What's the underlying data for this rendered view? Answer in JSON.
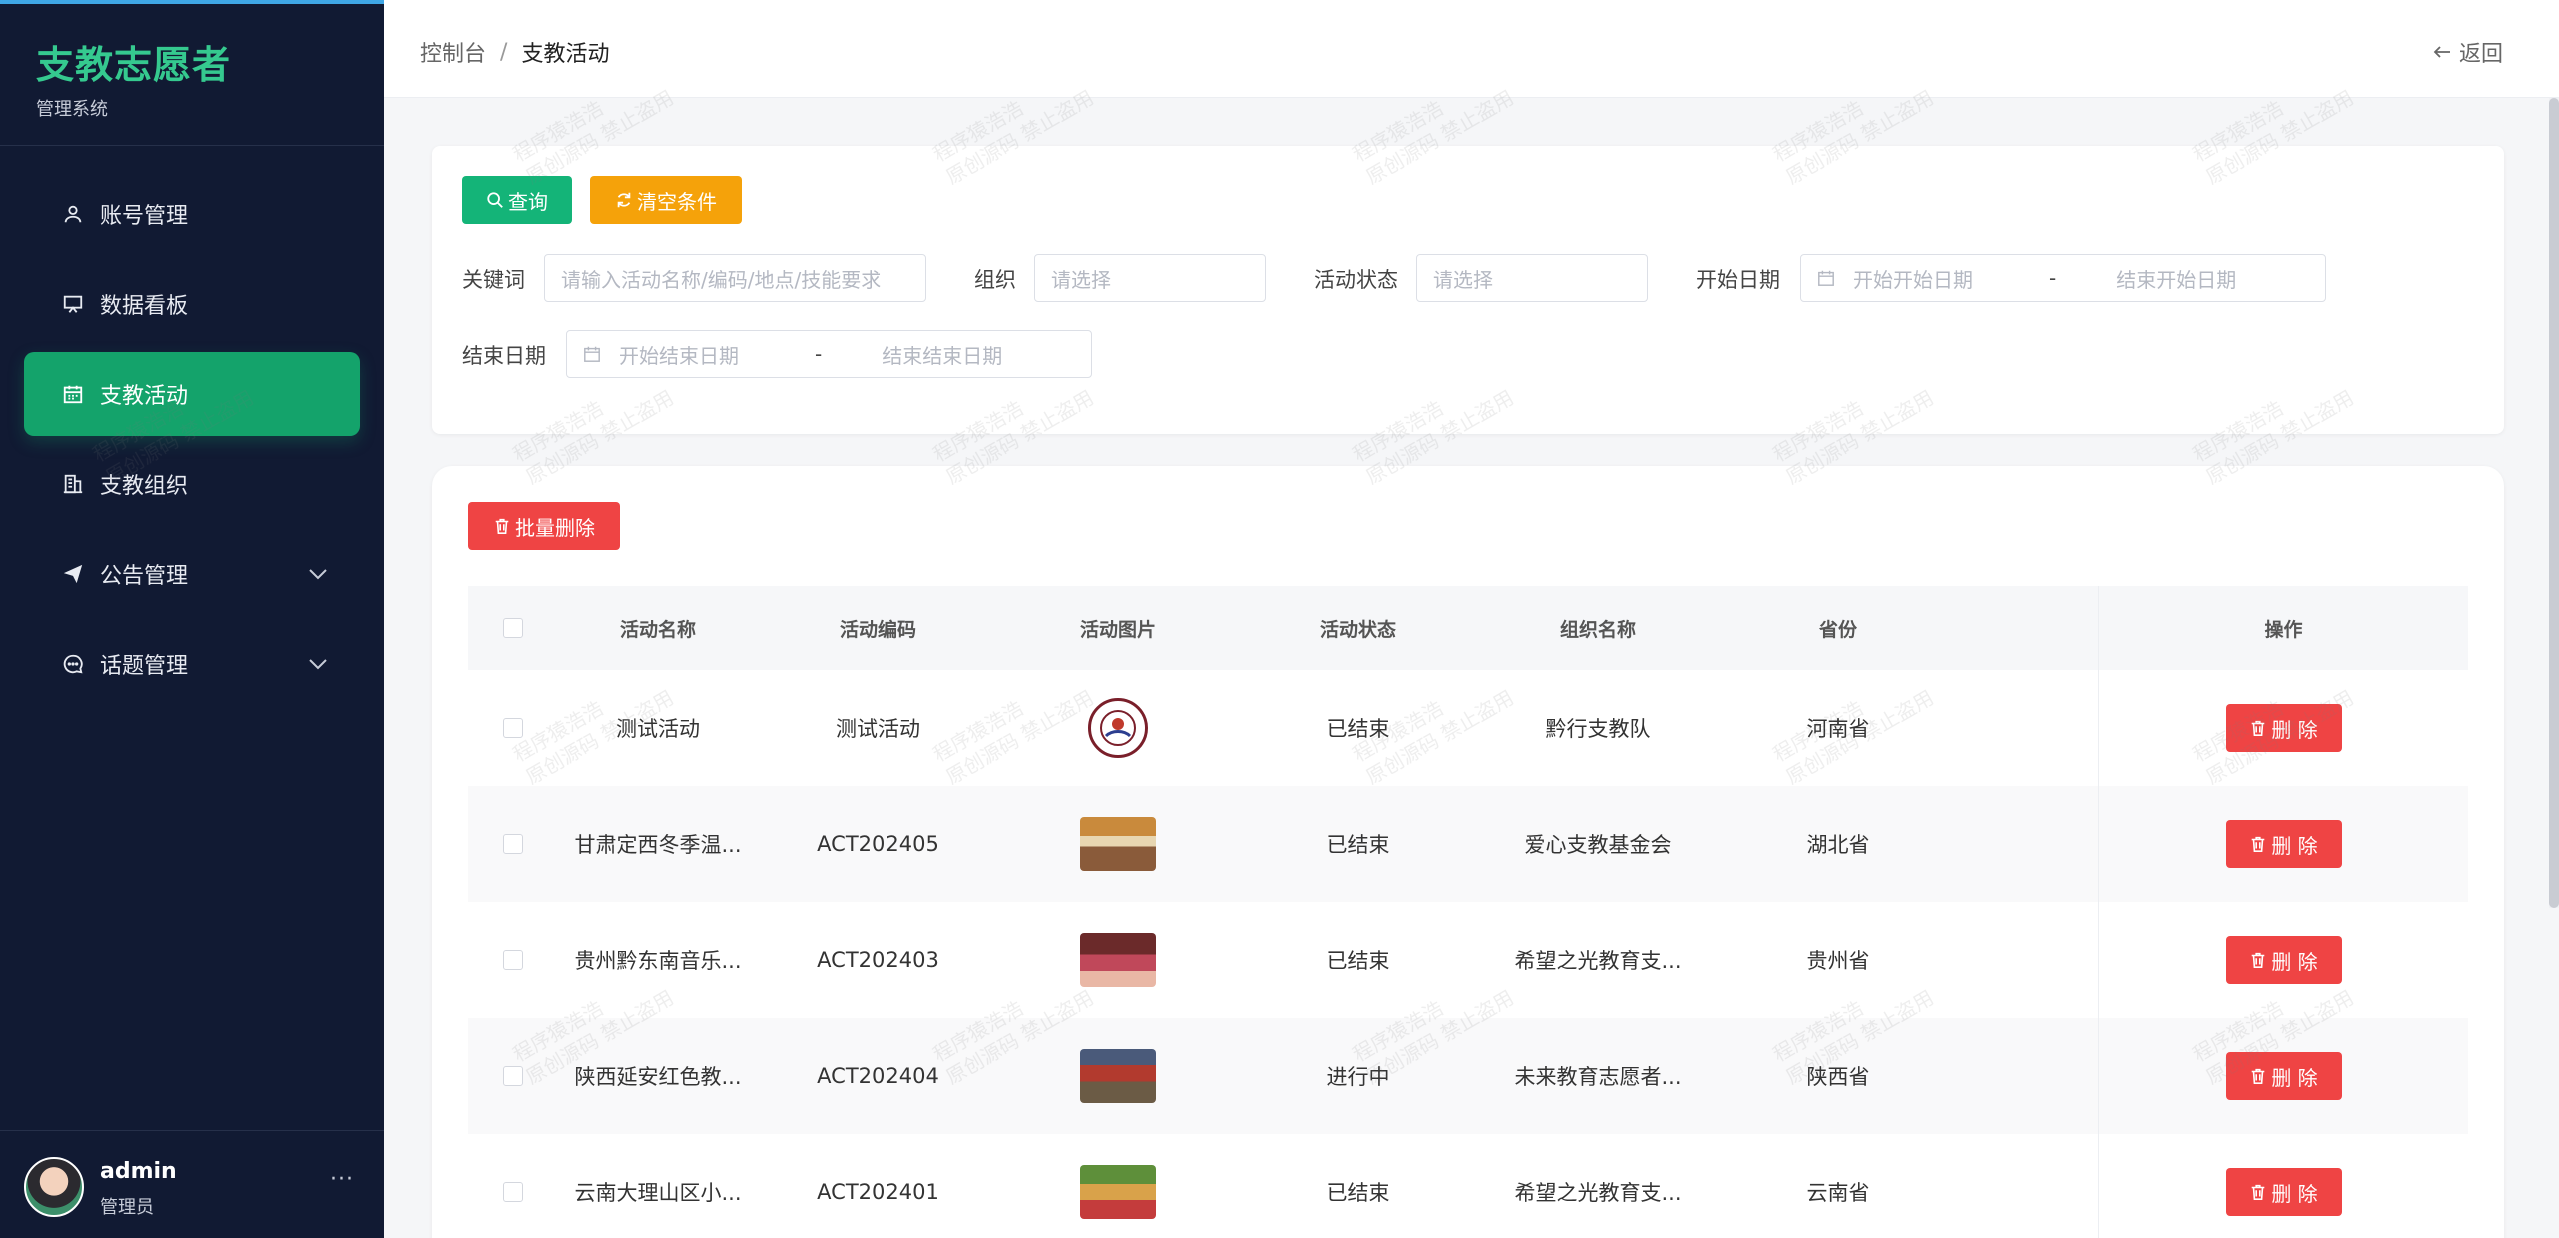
{
  "sidebar": {
    "brand_title": "支教志愿者",
    "brand_sub": "管理系统",
    "items": [
      {
        "label": "账号管理",
        "icon": "user-icon"
      },
      {
        "label": "数据看板",
        "icon": "board-icon"
      },
      {
        "label": "支教活动",
        "icon": "calendar-icon",
        "active": true
      },
      {
        "label": "支教组织",
        "icon": "building-icon"
      },
      {
        "label": "公告管理",
        "icon": "send-icon",
        "expandable": true
      },
      {
        "label": "话题管理",
        "icon": "chat-icon",
        "expandable": true
      }
    ],
    "user": {
      "name": "admin",
      "role": "管理员",
      "more": "···"
    }
  },
  "header": {
    "breadcrumb": [
      "控制台",
      "支教活动"
    ],
    "breadcrumb_sep": "/",
    "back_label": "返回"
  },
  "filter": {
    "query_label": "查询",
    "clear_label": "清空条件",
    "keyword_label": "关键词",
    "keyword_placeholder": "请输入活动名称/编码/地点/技能要求",
    "org_label": "组织",
    "org_placeholder": "请选择",
    "status_label": "活动状态",
    "status_placeholder": "请选择",
    "start_label": "开始日期",
    "start_from_placeholder": "开始开始日期",
    "start_to_placeholder": "结束开始日期",
    "end_label": "结束日期",
    "end_from_placeholder": "开始结束日期",
    "end_to_placeholder": "结束结束日期",
    "range_sep": "-"
  },
  "table": {
    "batch_delete_label": "批量删除",
    "columns": [
      "活动名称",
      "活动编码",
      "活动图片",
      "活动状态",
      "组织名称",
      "省份",
      "操作"
    ],
    "delete_label": "删 除",
    "rows": [
      {
        "name": "测试活动",
        "code": "测试活动",
        "image": "logo",
        "status": "已结束",
        "org": "黔行支教队",
        "province": "河南省"
      },
      {
        "name": "甘肃定西冬季温...",
        "code": "ACT202405",
        "image": "photo-1",
        "status": "已结束",
        "org": "爱心支教基金会",
        "province": "湖北省"
      },
      {
        "name": "贵州黔东南音乐...",
        "code": "ACT202403",
        "image": "photo-2",
        "status": "已结束",
        "org": "希望之光教育支...",
        "province": "贵州省"
      },
      {
        "name": "陕西延安红色教...",
        "code": "ACT202404",
        "image": "photo-3",
        "status": "进行中",
        "org": "未来教育志愿者...",
        "province": "陕西省"
      },
      {
        "name": "云南大理山区小...",
        "code": "ACT202401",
        "image": "photo-4",
        "status": "已结束",
        "org": "希望之光教育支...",
        "province": "云南省"
      }
    ]
  },
  "watermark": {
    "line1": "程序猿浩浩",
    "line2": "原创源码 禁止盗用"
  },
  "colors": {
    "primary": "#14a36b",
    "warning": "#f5a20a",
    "danger": "#ef4444",
    "sidebar_bg": "#111a33",
    "brand": "#35c98f"
  }
}
